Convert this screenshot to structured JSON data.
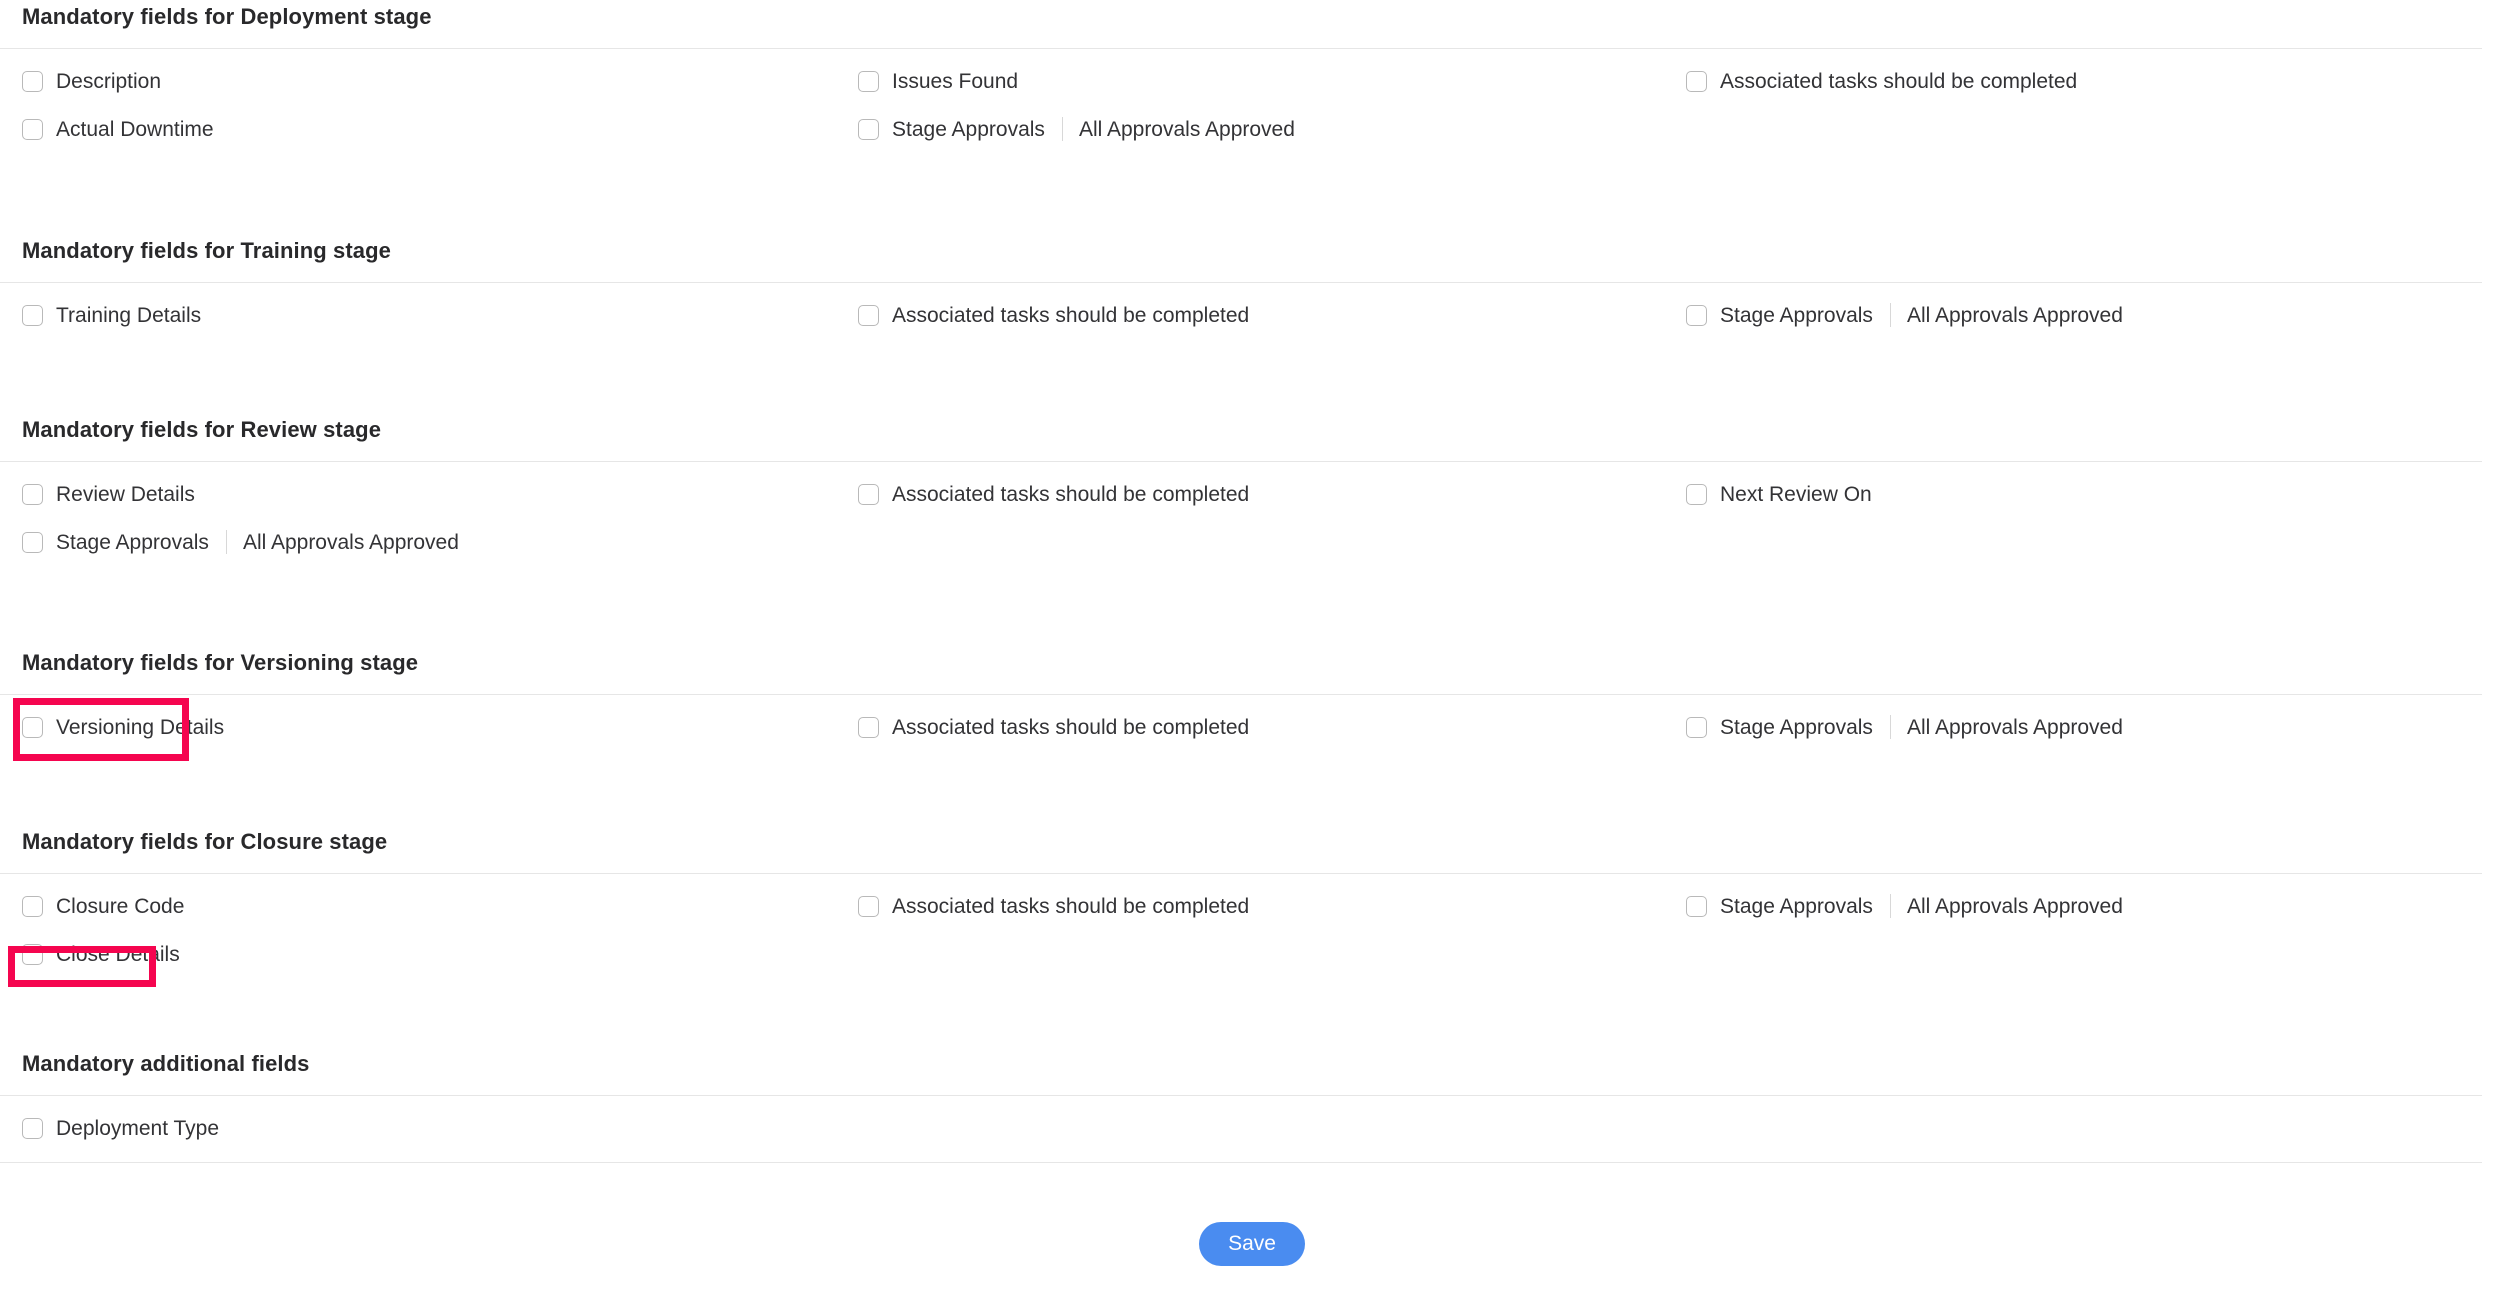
{
  "accent": {
    "annotation_color": "#f5054f",
    "save_button_color": "#4a8cf0",
    "divider_color": "#e6e6e6",
    "checkbox_border_color": "#b9b9b9"
  },
  "sections": [
    {
      "title": "Mandatory fields for Deployment stage",
      "rows": [
        {
          "col1": {
            "label": "Description",
            "checked": false
          },
          "col2": {
            "label": "Issues Found",
            "checked": false
          },
          "col3": {
            "label": "Associated tasks should be completed",
            "checked": false
          }
        },
        {
          "col1": {
            "label": "Actual Downtime",
            "checked": false
          },
          "col2": {
            "label": "Stage Approvals",
            "checked": false,
            "sub": "All Approvals Approved"
          },
          "col3": null
        }
      ]
    },
    {
      "title": "Mandatory fields for Training stage",
      "rows": [
        {
          "col1": {
            "label": "Training Details",
            "checked": false
          },
          "col2": {
            "label": "Associated tasks should be completed",
            "checked": false
          },
          "col3": {
            "label": "Stage Approvals",
            "checked": false,
            "sub": "All Approvals Approved"
          }
        }
      ]
    },
    {
      "title": "Mandatory fields for Review stage",
      "rows": [
        {
          "col1": {
            "label": "Review Details",
            "checked": false
          },
          "col2": {
            "label": "Associated tasks should be completed",
            "checked": false
          },
          "col3": {
            "label": "Next Review On",
            "checked": false
          }
        },
        {
          "col1": {
            "label": "Stage Approvals",
            "checked": false,
            "sub": "All Approvals Approved"
          },
          "col2": null,
          "col3": null
        }
      ]
    },
    {
      "title": "Mandatory fields for Versioning stage",
      "rows": [
        {
          "col1": {
            "label": "Versioning Details",
            "checked": false
          },
          "col2": {
            "label": "Associated tasks should be completed",
            "checked": false
          },
          "col3": {
            "label": "Stage Approvals",
            "checked": false,
            "sub": "All Approvals Approved"
          }
        }
      ]
    },
    {
      "title": "Mandatory fields for Closure stage",
      "rows": [
        {
          "col1": {
            "label": "Closure Code",
            "checked": false
          },
          "col2": {
            "label": "Associated tasks should be completed",
            "checked": false
          },
          "col3": {
            "label": "Stage Approvals",
            "checked": false,
            "sub": "All Approvals Approved"
          }
        },
        {
          "col1": {
            "label": "Close Details",
            "checked": false
          },
          "col2": null,
          "col3": null
        }
      ]
    },
    {
      "title": "Mandatory additional fields",
      "rows": [
        {
          "col1": {
            "label": "Deployment Type",
            "checked": false
          },
          "col2": null,
          "col3": null
        }
      ]
    }
  ],
  "annotations": [
    {
      "target": "versioning-details-checkbox-field"
    },
    {
      "target": "close-details-checkbox-field"
    }
  ],
  "footer": {
    "save_label": "Save"
  }
}
